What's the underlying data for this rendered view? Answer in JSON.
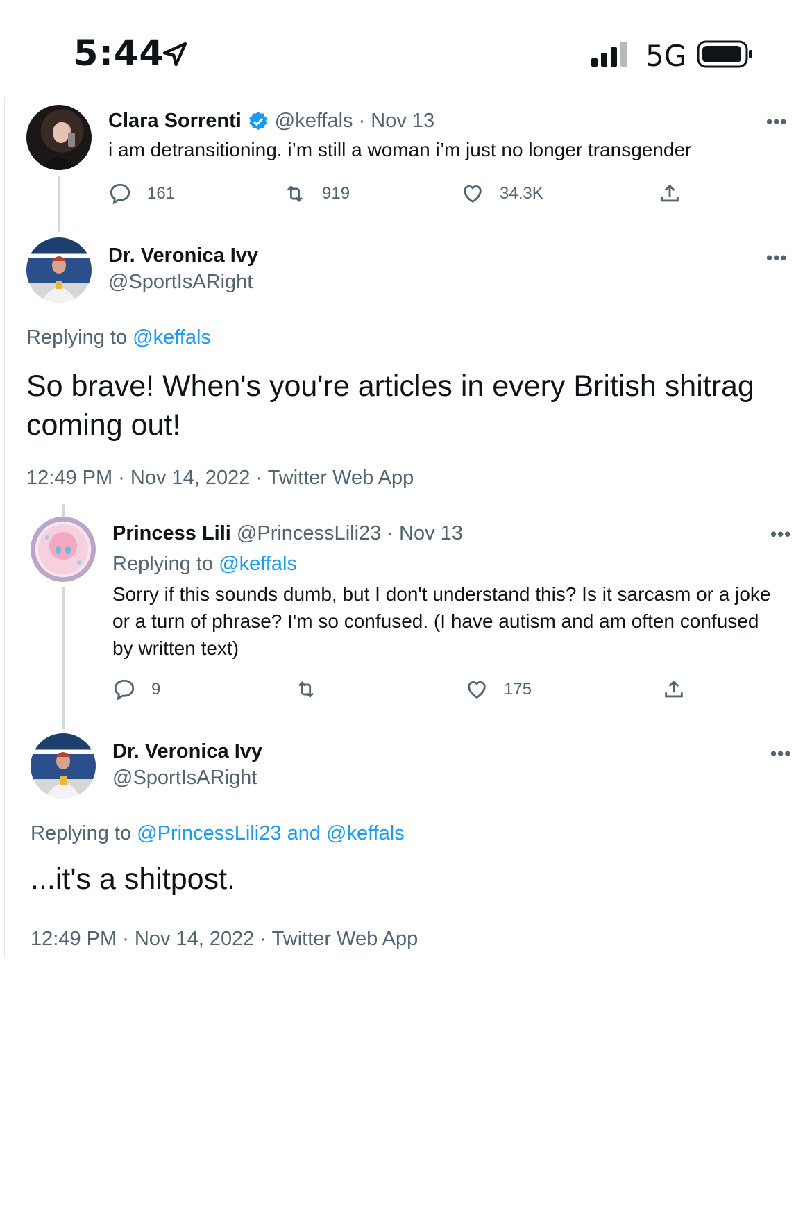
{
  "status": {
    "time": "5:44",
    "network": "5G"
  },
  "tweet1": {
    "name": "Clara Sorrenti",
    "handle_date": "@keffals · Nov 13",
    "text": "i am detransitioning. i’m still a woman i’m just no longer transgender",
    "replies": "161",
    "retweets": "919",
    "likes": "34.3K"
  },
  "tweet2": {
    "name": "Dr. Veronica Ivy",
    "handle": "@SportIsARight",
    "replying_prefix": "Replying to",
    "replying_to": "@keffals",
    "text": "So brave! When's you're articles in every British shitrag coming out!",
    "footer": "12:49 PM · Nov 14, 2022 · Twitter Web App"
  },
  "tweet3": {
    "name": "Princess Lili",
    "handle_date": "@PrincessLili23 · Nov 13",
    "replying_prefix": "Replying to",
    "replying_to": "@keffals",
    "text": "Sorry if this sounds dumb, but I don't understand this? Is it sarcasm or a joke or a turn of phrase? I'm so confused. (I have autism and am often confused by written text)",
    "replies": "9",
    "likes": "175"
  },
  "tweet4": {
    "name": "Dr. Veronica Ivy",
    "handle": "@SportIsARight",
    "replying_prefix": "Replying to",
    "replying_to": "@PrincessLili23 and @keffals",
    "text": "...it's a shitpost.",
    "footer": "12:49 PM · Nov 14, 2022 · Twitter Web App"
  },
  "more_label": "•••",
  "icons": [
    "location-arrow-icon",
    "signal-icon",
    "battery-icon",
    "verified-badge-icon",
    "reply-icon",
    "retweet-icon",
    "like-icon",
    "share-icon",
    "more-icon"
  ],
  "colors": {
    "link": "#1d9bf0",
    "muted": "#536471",
    "verified": "#1d9bf0"
  }
}
